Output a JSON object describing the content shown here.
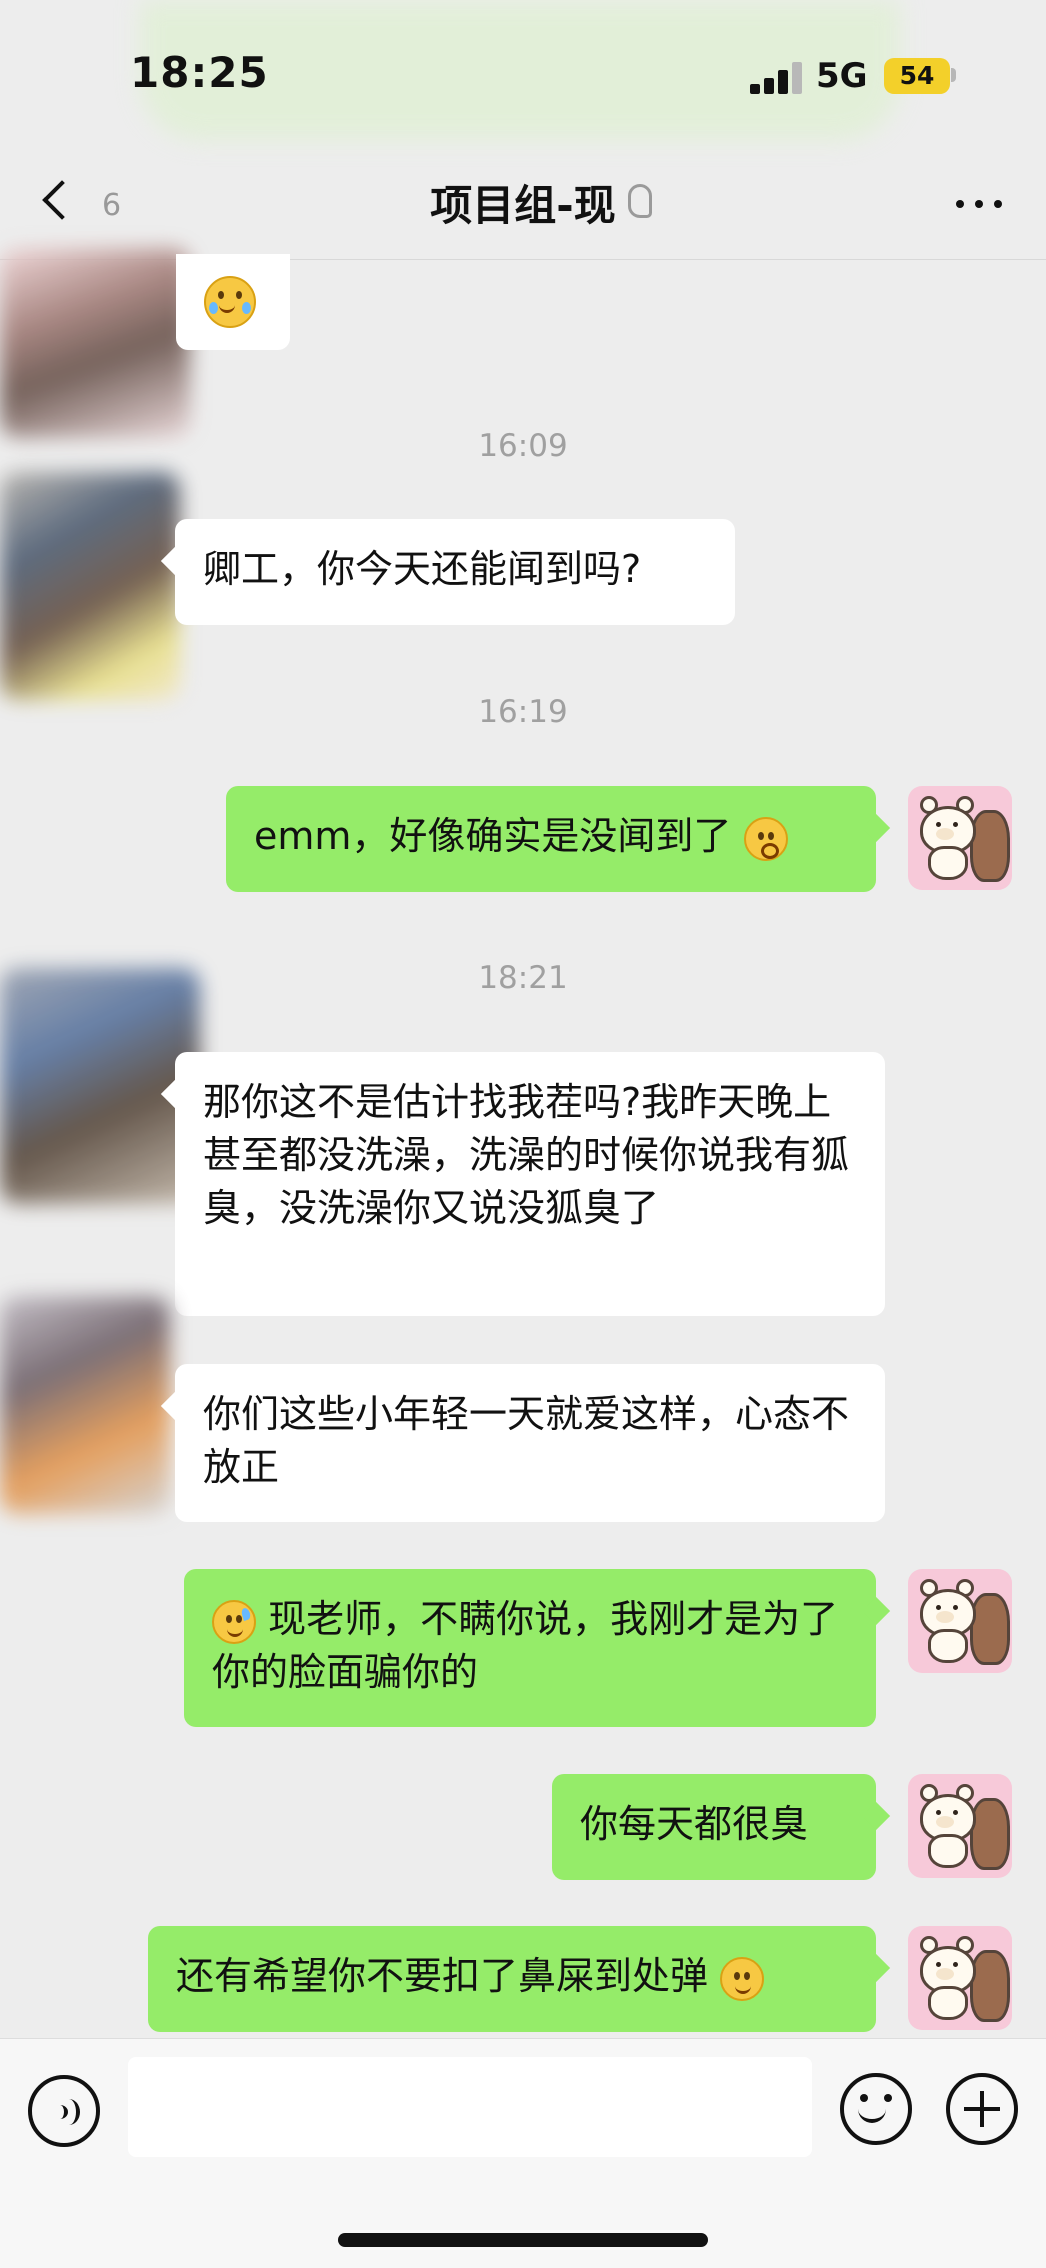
{
  "status_bar": {
    "time": "18:25",
    "network": "5G",
    "battery_level": "54",
    "battery_color": "#f3d02a"
  },
  "header": {
    "back_count": "6",
    "title": "项目组-现",
    "icons": {
      "back": "back-icon",
      "mute": "mute-icon",
      "more": "more-icon"
    }
  },
  "chat": {
    "top_emoji": "laugh-cry-emoji",
    "timestamps": [
      "16:09",
      "16:19",
      "18:21"
    ],
    "messages": [
      {
        "direction": "incoming",
        "text": "卿工，你今天还能闻到吗?"
      },
      {
        "direction": "outgoing",
        "text": "emm，好像确实是没闻到了",
        "emoji": "shock-face-emoji"
      },
      {
        "direction": "incoming",
        "text": "那你这不是估计找我茬吗?我昨天晚上甚至都没洗澡，洗澡的时候你说我有狐臭，没洗澡你又说没狐臭了"
      },
      {
        "direction": "incoming",
        "text": "你们这些小年轻一天就爱这样，心态不放正"
      },
      {
        "direction": "outgoing",
        "text": "现老师，不瞒你说，我刚才是为了你的脸面骗你的",
        "emoji": "sweat-smile-emoji"
      },
      {
        "direction": "outgoing",
        "text": "你每天都很臭"
      },
      {
        "direction": "outgoing",
        "text": "还有希望你不要扣了鼻屎到处弹",
        "emoji": "smile-emoji"
      }
    ]
  },
  "input_bar": {
    "placeholder": "",
    "voice_icon": "voice-icon",
    "emoji_icon": "emoji-icon",
    "plus_icon": "plus-icon"
  },
  "colors": {
    "chat_background": "#ededed",
    "incoming_bubble": "#ffffff",
    "outgoing_bubble": "#95ec69"
  }
}
